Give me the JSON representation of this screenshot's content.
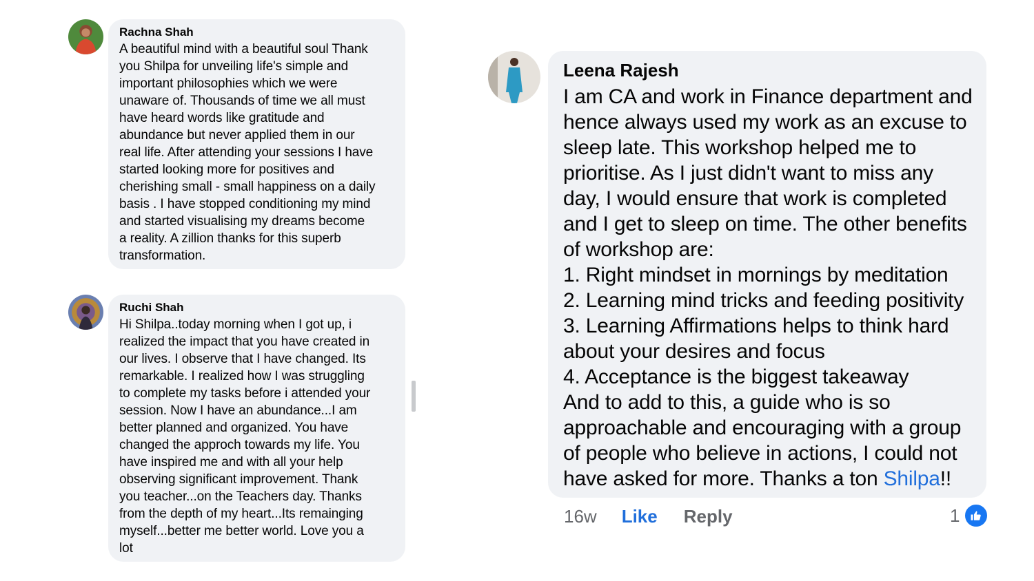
{
  "comments": [
    {
      "author": "Rachna Shah",
      "text": "A beautiful mind with a beautiful soul Thank\nyou Shilpa for unveiling life's simple and\nimportant philosophies which we were\nunaware of. Thousands of time we all must\nhave heard words like gratitude and\nabundance but never applied them in our\nreal life. After attending your sessions I have\nstarted looking more for positives and\ncherishing small - small happiness on a daily\nbasis . I have stopped conditioning my mind\nand started visualising my dreams become\na reality. A zillion  thanks for this superb\ntransformation."
    },
    {
      "author": "Ruchi Shah",
      "text": "Hi Shilpa..today morning when I got up, i\nrealized the impact that you have created in\nour lives. I observe that I have changed. Its\nremarkable. I realized how I was struggling\nto complete my tasks before i attended your\nsession. Now I have an abundance...I am\nbetter planned and organized. You have\nchanged the approch towards my life. You\nhave inspired me and with all your help\nobserving significant improvement. Thank\nyou teacher...on the Teachers day.  Thanks\nfrom the depth of my heart...Its remainging\nmyself...better me better world. Love you a\nlot"
    },
    {
      "author": "Leena Rajesh",
      "text": "I am CA and work in Finance department and\nhence always used my work as an excuse to\nsleep late. This workshop helped me to\nprioritise. As I just didn't want to miss any\nday, I would ensure that work is completed\nand I get to sleep on time. The other benefits\nof workshop are:\n1. Right mindset in mornings by meditation\n2. Learning mind tricks and feeding positivity\n3. Learning Affirmations helps to think hard\nabout your desires and focus\n4. Acceptance is the biggest takeaway\nAnd to add to this, a guide who is so\napproachable and encouraging with a group\nof people who believe in actions, I could not\nhave asked for more. Thanks a ton ",
      "mention": "Shilpa",
      "text_end": "!!",
      "time": "16w",
      "like_label": "Like",
      "reply_label": "Reply",
      "reaction_count": "1",
      "reaction_icon": "thumbs-up-icon"
    }
  ],
  "colors": {
    "bubble": "#f0f2f5",
    "link": "#216fdb",
    "meta": "#65676b",
    "like_badge": "#1877f2"
  }
}
